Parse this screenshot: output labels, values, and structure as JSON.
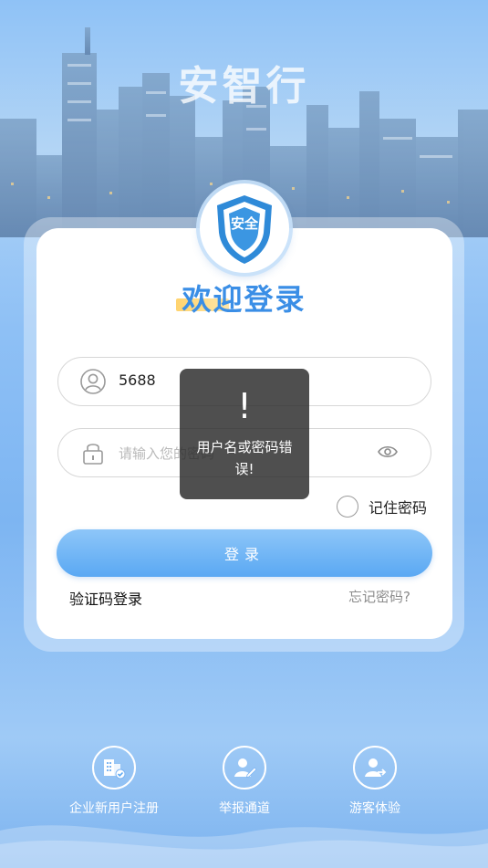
{
  "app": {
    "title": "安智行"
  },
  "logo": {
    "badge_text": "安全"
  },
  "login": {
    "welcome": "欢迎登录",
    "username_value": "5688",
    "password_placeholder": "请输入您的密码",
    "remember_label": "记住密码",
    "submit_label": "登录",
    "sms_login_label": "验证码登录",
    "forgot_label": "忘记密码?"
  },
  "toast": {
    "icon": "!",
    "message": "用户名或密码错误!"
  },
  "bottom_nav": [
    {
      "label": "企业新用户注册",
      "icon": "building-check-icon"
    },
    {
      "label": "举报通道",
      "icon": "user-edit-icon"
    },
    {
      "label": "游客体验",
      "icon": "user-arrow-icon"
    }
  ],
  "colors": {
    "accent": "#3a8ee6",
    "button": "#5aa8f3",
    "highlight": "#ffd36e",
    "toast_bg": "#282828"
  }
}
